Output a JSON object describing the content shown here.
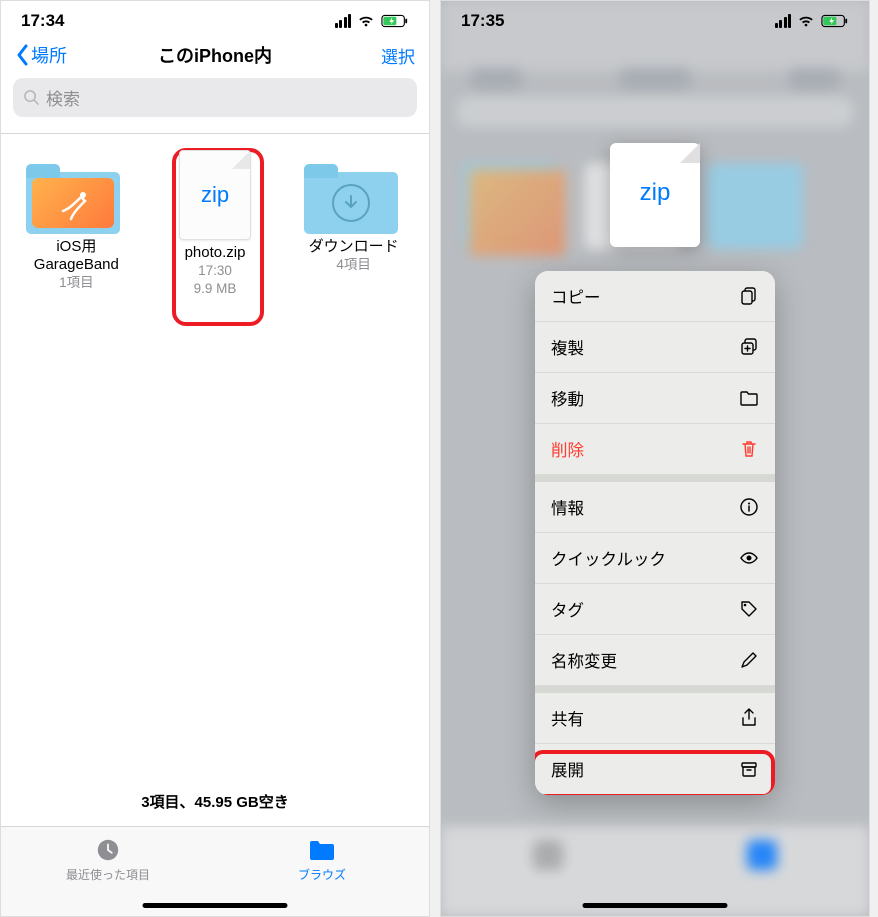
{
  "left": {
    "status": {
      "time": "17:34"
    },
    "nav": {
      "back_label": "場所",
      "title": "このiPhone内",
      "select_label": "選択"
    },
    "search": {
      "placeholder": "検索"
    },
    "items": [
      {
        "name_line1": "iOS用",
        "name_line2": "GarageBand",
        "meta": "1項目"
      },
      {
        "name_line1": "photo.zip",
        "ext": "zip",
        "meta_line1": "17:30",
        "meta_line2": "9.9 MB"
      },
      {
        "name_line1": "ダウンロード",
        "meta": "4項目"
      }
    ],
    "bottom_status": "3項目、45.95 GB空き",
    "tabs": {
      "recent": "最近使った項目",
      "browse": "ブラウズ"
    }
  },
  "right": {
    "status": {
      "time": "17:35"
    },
    "preview_ext": "zip",
    "menu": [
      {
        "label": "コピー",
        "icon": "copy"
      },
      {
        "label": "複製",
        "icon": "duplicate"
      },
      {
        "label": "移動",
        "icon": "folder"
      },
      {
        "label": "削除",
        "icon": "trash",
        "destructive": true
      },
      {
        "sep": true
      },
      {
        "label": "情報",
        "icon": "info"
      },
      {
        "label": "クイックルック",
        "icon": "eye"
      },
      {
        "label": "タグ",
        "icon": "tag"
      },
      {
        "label": "名称変更",
        "icon": "pencil"
      },
      {
        "sep": true
      },
      {
        "label": "共有",
        "icon": "share"
      },
      {
        "label": "展開",
        "icon": "archive"
      }
    ]
  }
}
